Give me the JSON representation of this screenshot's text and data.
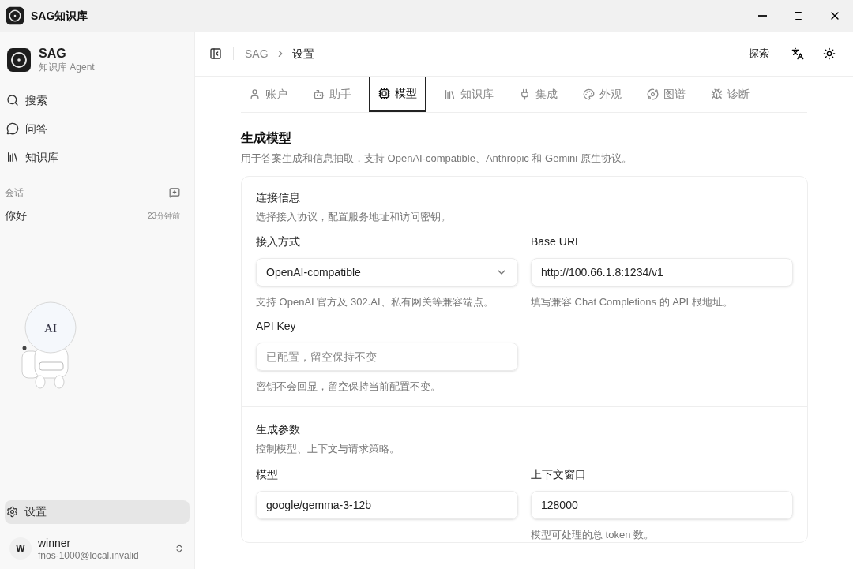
{
  "window": {
    "title": "SAG知识库"
  },
  "sidebar": {
    "brand": {
      "name": "SAG",
      "subtitle": "知识库 Agent"
    },
    "nav": [
      {
        "label": "搜索",
        "selected": false
      },
      {
        "label": "问答",
        "selected": false
      },
      {
        "label": "知识库",
        "selected": false
      }
    ],
    "sessions_heading": "会话",
    "sessions": [
      {
        "title": "你好",
        "time": "23分钟前"
      }
    ],
    "illustration_text": "AI",
    "settings": {
      "label": "设置",
      "selected": true
    },
    "user": {
      "initial": "W",
      "name": "winner",
      "email": "fnos-1000@local.invalid"
    }
  },
  "header": {
    "breadcrumb": [
      "SAG",
      "设置"
    ],
    "explore": "探索"
  },
  "tabs": [
    {
      "label": "账户",
      "selected": false
    },
    {
      "label": "助手",
      "selected": false
    },
    {
      "label": "模型",
      "selected": true
    },
    {
      "label": "知识库",
      "selected": false
    },
    {
      "label": "集成",
      "selected": false
    },
    {
      "label": "外观",
      "selected": false
    },
    {
      "label": "图谱",
      "selected": false
    },
    {
      "label": "诊断",
      "selected": false
    }
  ],
  "page": {
    "title": "生成模型",
    "description": "用于答案生成和信息抽取，支持 OpenAI-compatible、Anthropic 和 Gemini 原生协议。"
  },
  "sections": [
    {
      "title": "连接信息",
      "description": "选择接入协议，配置服务地址和访问密钥。",
      "fields": [
        {
          "label": "接入方式",
          "kind": "select",
          "value": "OpenAI-compatible",
          "help": "支持 OpenAI 官方及 302.AI、私有网关等兼容端点。"
        },
        {
          "label": "Base URL",
          "kind": "text",
          "value": "http://100.66.1.8:1234/v1",
          "help": "填写兼容 Chat Completions 的 API 根地址。"
        },
        {
          "label": "API Key",
          "kind": "text",
          "placeholder": "已配置，留空保持不变",
          "help": "密钥不会回显，留空保持当前配置不变。"
        }
      ]
    },
    {
      "title": "生成参数",
      "description": "控制模型、上下文与请求策略。",
      "fields": [
        {
          "label": "模型",
          "kind": "text",
          "value": "google/gemma-3-12b"
        },
        {
          "label": "上下文窗口",
          "kind": "text",
          "value": "128000",
          "help": "模型可处理的总 token 数。"
        }
      ]
    }
  ]
}
